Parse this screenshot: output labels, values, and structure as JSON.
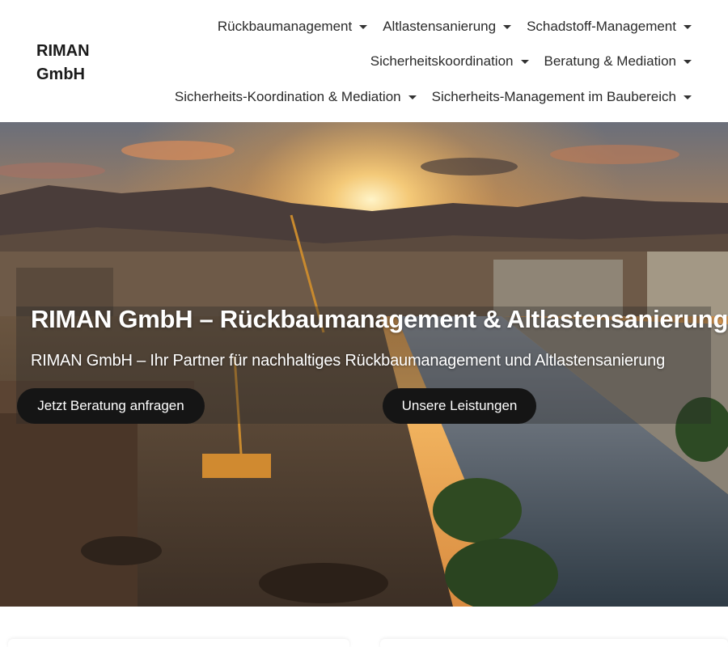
{
  "brand": {
    "logo_line1": "RIMAN",
    "logo_line2": "GmbH"
  },
  "nav": {
    "row1": [
      {
        "label": "Rückbaumanagement"
      },
      {
        "label": "Altlastensanierung"
      },
      {
        "label": "Schadstoff-Management"
      }
    ],
    "row2": [
      {
        "label": "Sicherheitskoordination"
      },
      {
        "label": "Beratung & Mediation"
      }
    ],
    "row3": [
      {
        "label": "Sicherheits-Koordination & Mediation"
      },
      {
        "label": "Sicherheits-Management im Baubereich"
      }
    ],
    "dropdown_icon": "caret-down"
  },
  "hero": {
    "title": "RIMAN GmbH – Rückbaumanagement & Altlastensanierung",
    "subtitle": "RIMAN GmbH – Ihr Partner für nachhaltiges Rückbaumanagement und Altlastensanierung",
    "cta_consult": "Jetzt Beratung anfragen",
    "cta_services": "Unsere Leistungen",
    "button_color": "#151515"
  }
}
